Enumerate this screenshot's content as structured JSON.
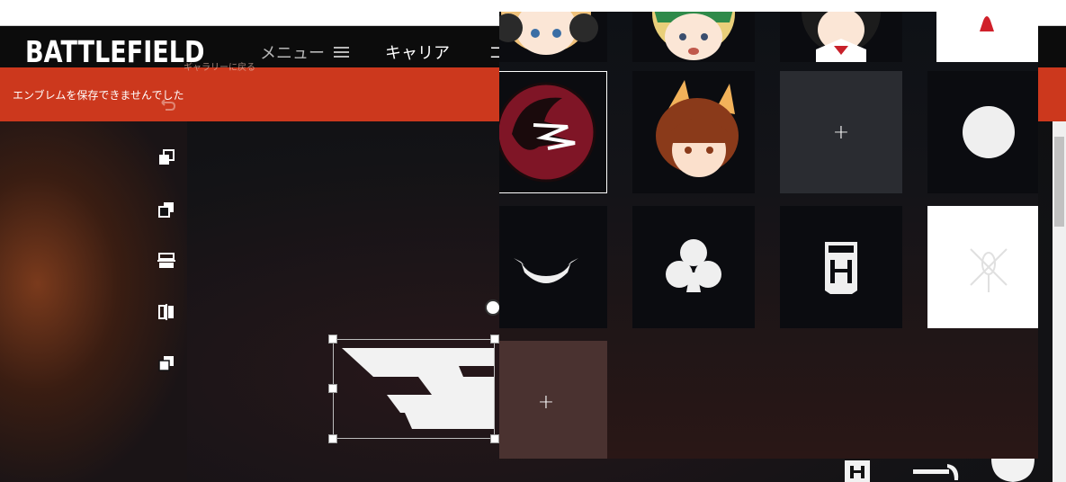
{
  "header": {
    "logo": "BATTLEFIELD",
    "nav": {
      "menu_label": "メニュー",
      "career_label": "キャリア",
      "cut_label": "コ"
    }
  },
  "error_banner": {
    "message": "エンブレムを保存できませんでした",
    "behind_text": "ギャラリーに戻る"
  },
  "tools": [
    {
      "icon": "bring-to-front-icon"
    },
    {
      "icon": "send-to-back-icon"
    },
    {
      "icon": "flip-vertical-icon"
    },
    {
      "icon": "flip-horizontal-icon"
    },
    {
      "icon": "duplicate-icon"
    }
  ],
  "emblem_library": {
    "add_label": "+",
    "tiles": [
      {
        "type": "anime-girl-blonde-headphones"
      },
      {
        "type": "anime-girl-green-hat"
      },
      {
        "type": "anime-girl-dark-hair"
      },
      {
        "type": "red-figure"
      },
      {
        "type": "red-circle-emblem",
        "selected": true
      },
      {
        "type": "fox-girl"
      },
      {
        "type": "add-slot"
      },
      {
        "type": "white-circle"
      },
      {
        "type": "horns"
      },
      {
        "type": "club-suit"
      },
      {
        "type": "vest-armor"
      },
      {
        "type": "helicopter"
      },
      {
        "type": "add-slot"
      }
    ]
  },
  "colors": {
    "error_red": "#cc381d",
    "header_bg": "#0c0c0c",
    "tile_bg": "#0b0c10",
    "add_tile_bg": "#2a2c31"
  }
}
